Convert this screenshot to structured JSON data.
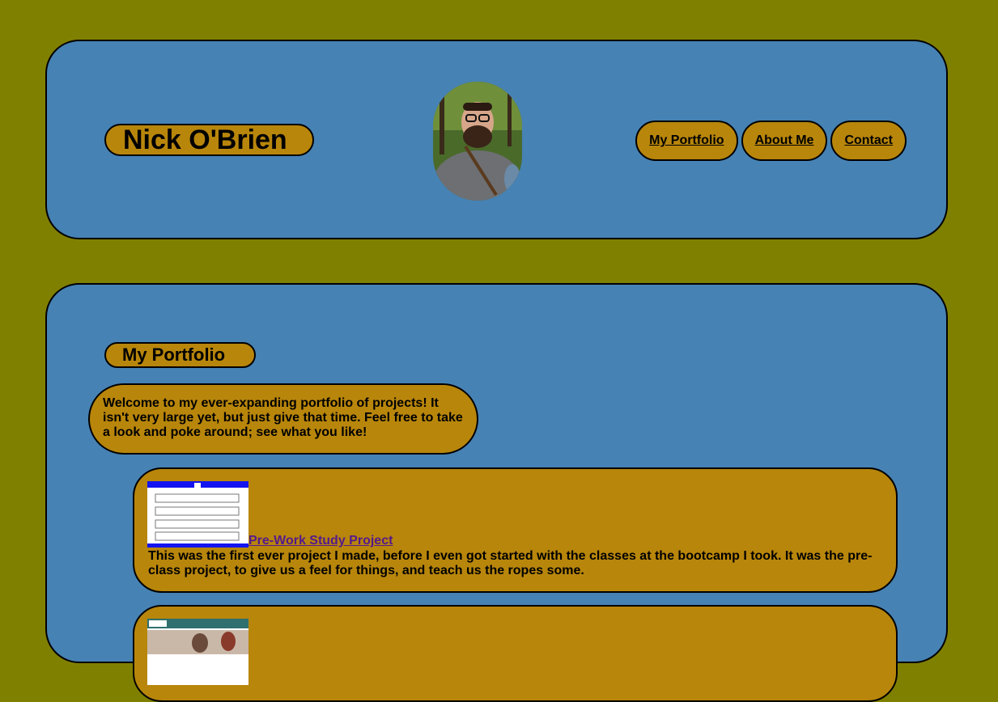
{
  "header": {
    "name": "Nick O'Brien",
    "nav": [
      {
        "label": "My Portfolio"
      },
      {
        "label": "About Me"
      },
      {
        "label": "Contact"
      }
    ]
  },
  "portfolio": {
    "title": "My Portfolio",
    "intro": "Welcome to my ever-expanding portfolio of projects! It isn't very large yet, but just give that time. Feel free to take a look and poke around; see what you like!",
    "projects": [
      {
        "link_label": "Pre-Work Study Project",
        "description": "This was the first ever project I made, before I even got started with the classes at the bootcamp I took. It was the pre-class project, to give us a feel for things, and teach us the ropes some."
      },
      {
        "link_label": "",
        "description": ""
      }
    ]
  },
  "colors": {
    "page_bg": "#808000",
    "card_bg": "#4682b4",
    "pill_bg": "#b8860b",
    "link": "#551a8b"
  }
}
